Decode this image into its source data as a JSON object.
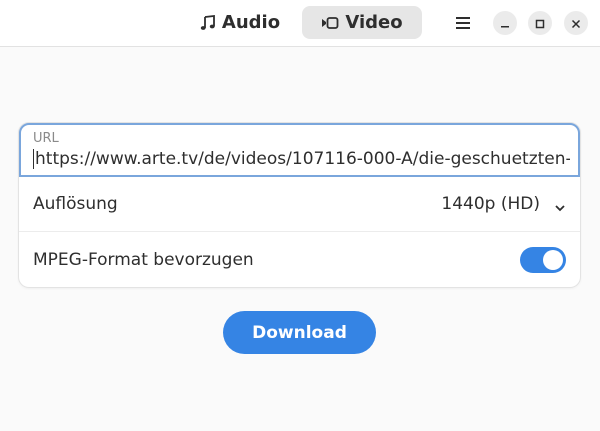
{
  "header": {
    "tabs": [
      {
        "label": "Audio",
        "icon": "music-note-icon",
        "active": false
      },
      {
        "label": "Video",
        "icon": "video-camera-icon",
        "active": true
      }
    ],
    "menu_icon": "hamburger-menu-icon",
    "window_controls": [
      "minimize-icon",
      "maximize-icon",
      "close-icon"
    ]
  },
  "form": {
    "url": {
      "label": "URL",
      "value": "https://www.arte.tv/de/videos/107116-000-A/die-geschuetzten-"
    },
    "resolution": {
      "label": "Auflösung",
      "value": "1440p (HD)"
    },
    "mpeg": {
      "label": "MPEG-Format bevorzugen",
      "enabled": true
    }
  },
  "actions": {
    "download_label": "Download"
  },
  "colors": {
    "accent": "#3584e4",
    "focus_border": "#7aa6dc",
    "background": "#fafafa"
  }
}
